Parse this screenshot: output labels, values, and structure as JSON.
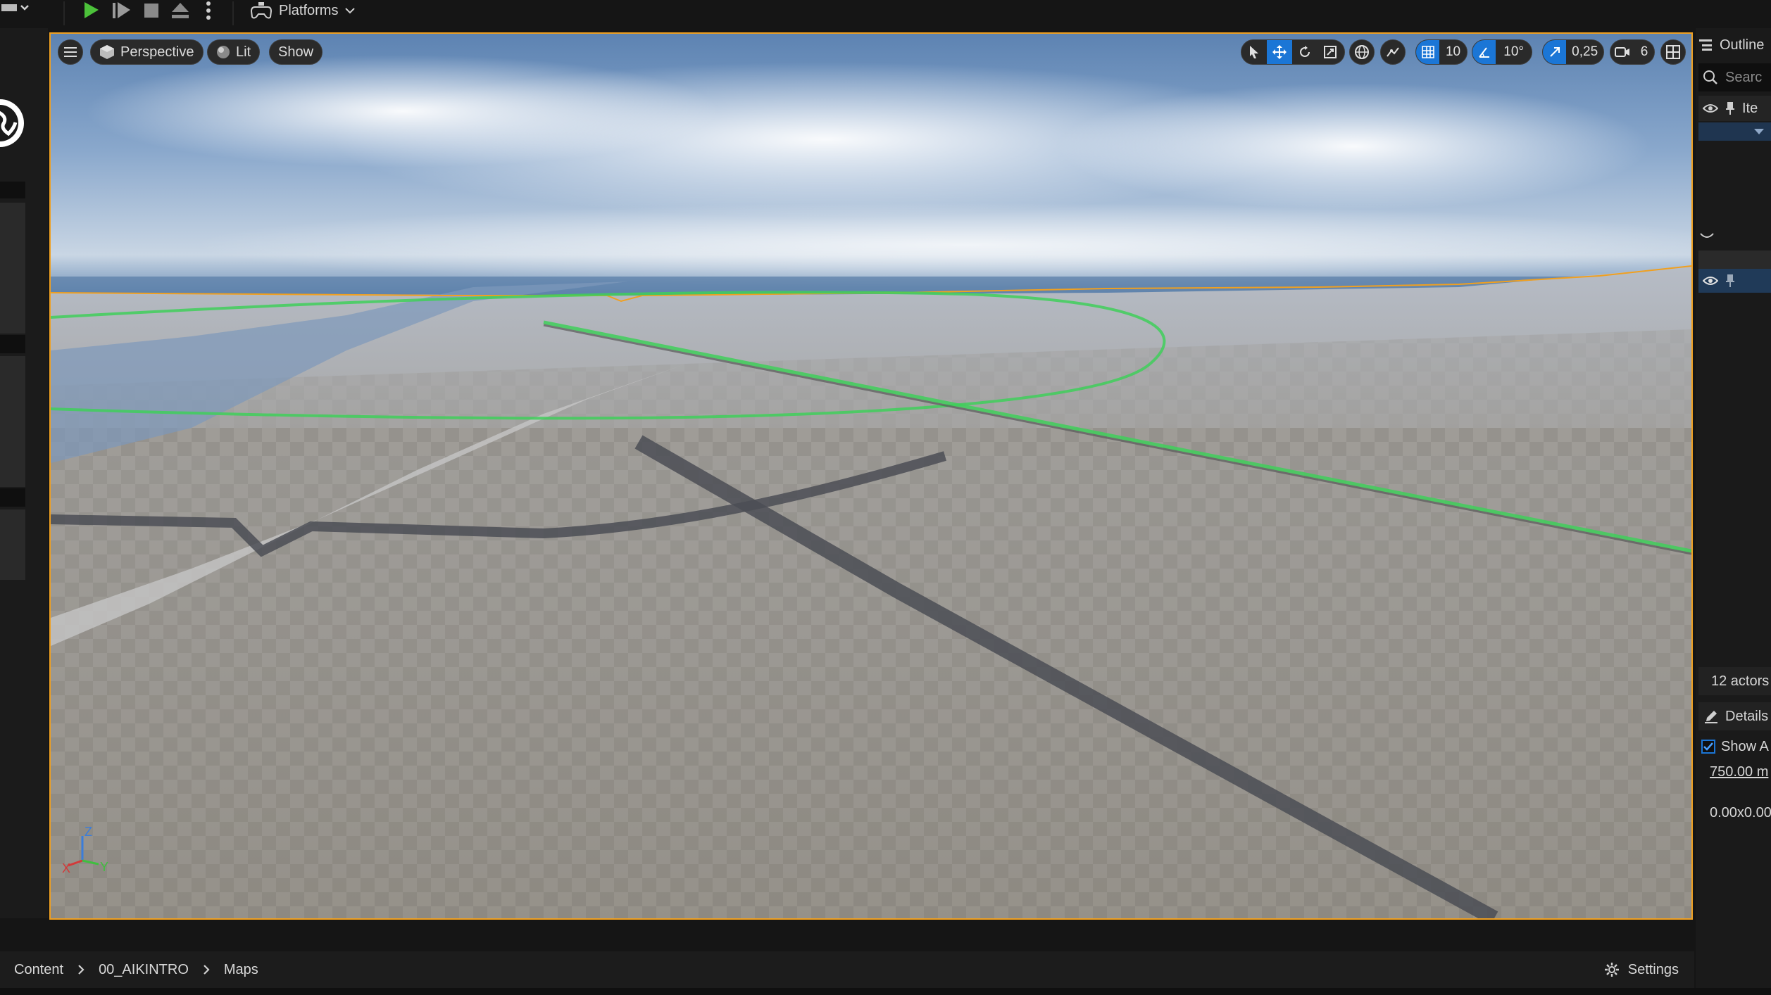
{
  "toolbar": {
    "platforms_label": "Platforms"
  },
  "viewport": {
    "view_mode": "Perspective",
    "lighting_mode": "Lit",
    "show_label": "Show",
    "grid_snap": "10",
    "rotation_snap": "10°",
    "scale_snap": "0,25",
    "camera_speed": "6",
    "axis_labels": {
      "x": "X",
      "y": "Y",
      "z": "Z"
    }
  },
  "outliner": {
    "title": "Outline",
    "search_placeholder": "Searc",
    "column_item": "Ite",
    "actor_count": "12 actors"
  },
  "details": {
    "title": "Details",
    "show_label": "Show A",
    "distance_value": "750.00 m",
    "size_value": "0.00x0.00"
  },
  "content_browser": {
    "breadcrumb": [
      "Content",
      "00_AIKINTRO",
      "Maps"
    ],
    "settings_label": "Settings"
  },
  "colors": {
    "accent_blue": "#1b76d6",
    "selection_orange": "#f0a020",
    "spline_green": "#3fcf5a",
    "play_green": "#4cc13a"
  }
}
